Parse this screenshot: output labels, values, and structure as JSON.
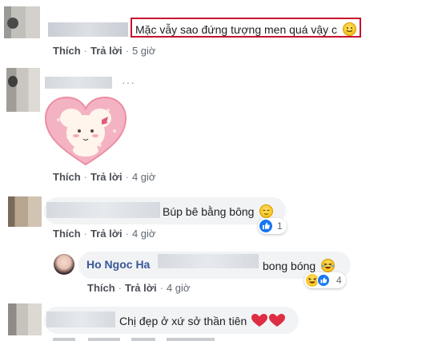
{
  "actions": {
    "like": "Thích",
    "reply": "Trả lời",
    "dot": "·"
  },
  "comments": [
    {
      "text": "Mặc vẫy sao đứng tượng men quá vậy c",
      "time": "5 giờ",
      "emoji": "smile-emoji"
    },
    {
      "time": "4 giờ",
      "more": "···",
      "sticker": "pink-bunny-heart-sticker"
    },
    {
      "text": "Búp bê bằng bông",
      "time": "4 giờ",
      "emoji": "relieved-emoji",
      "reactions": {
        "icon": "like-reaction-icon",
        "count": "1"
      }
    },
    {
      "name": "Ho Ngoc Ha",
      "text": "bong bóng",
      "time": "4 giờ",
      "emoji": "laughing-tears-emoji",
      "reactions": {
        "icons": [
          "haha-reaction-icon",
          "like-reaction-icon"
        ],
        "count": "4"
      }
    },
    {
      "text": "Chị đẹp ở xứ sở thần tiên",
      "emoji": "two-red-hearts"
    }
  ],
  "colors": {
    "highlight_border": "#c8102e",
    "link_name": "#385898",
    "bubble": "#f2f3f5",
    "like_blue": "#1877f2"
  }
}
